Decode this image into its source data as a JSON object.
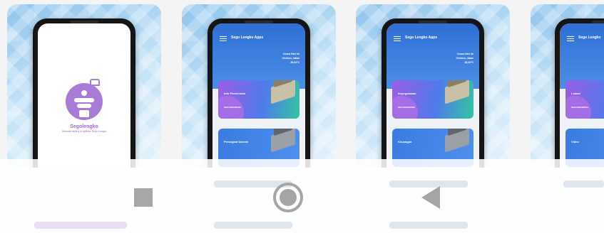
{
  "screens": [
    {
      "type": "splash",
      "brand": "Segolengko",
      "tagline": "Selamat datang di aplikasi Sego Lengko"
    },
    {
      "type": "app",
      "app_title": "Sego Lengko Apps",
      "welcome": [
        "Cuaca Hari Ini",
        "Cirebon, Jabar",
        "26,34°C"
      ],
      "tiles": [
        {
          "label": "Info Pemerintah",
          "code": "SEGOSERBIPRA"
        },
        {
          "label": "Perangkat Daerah",
          "code": ""
        }
      ]
    },
    {
      "type": "app",
      "app_title": "Sego Lengko Apps",
      "welcome": [
        "Cuaca Hari Ini",
        "Cirebon, Jabar",
        "26,34°C"
      ],
      "tiles": [
        {
          "label": "Kepegawaian",
          "code": "SEGOSERBIPRA"
        },
        {
          "label": "Keuangan",
          "code": ""
        }
      ]
    },
    {
      "type": "app",
      "app_title": "Sego Lengko",
      "welcome": [],
      "tiles": [
        {
          "label": "Lokasi",
          "code": "SEGOSERBIPRA"
        },
        {
          "label": "Video",
          "code": ""
        }
      ]
    }
  ],
  "navigation": {
    "icons": [
      "recents-square-icon",
      "home-circle-icon",
      "back-triangle-icon"
    ],
    "color": "#a5a5a5"
  }
}
